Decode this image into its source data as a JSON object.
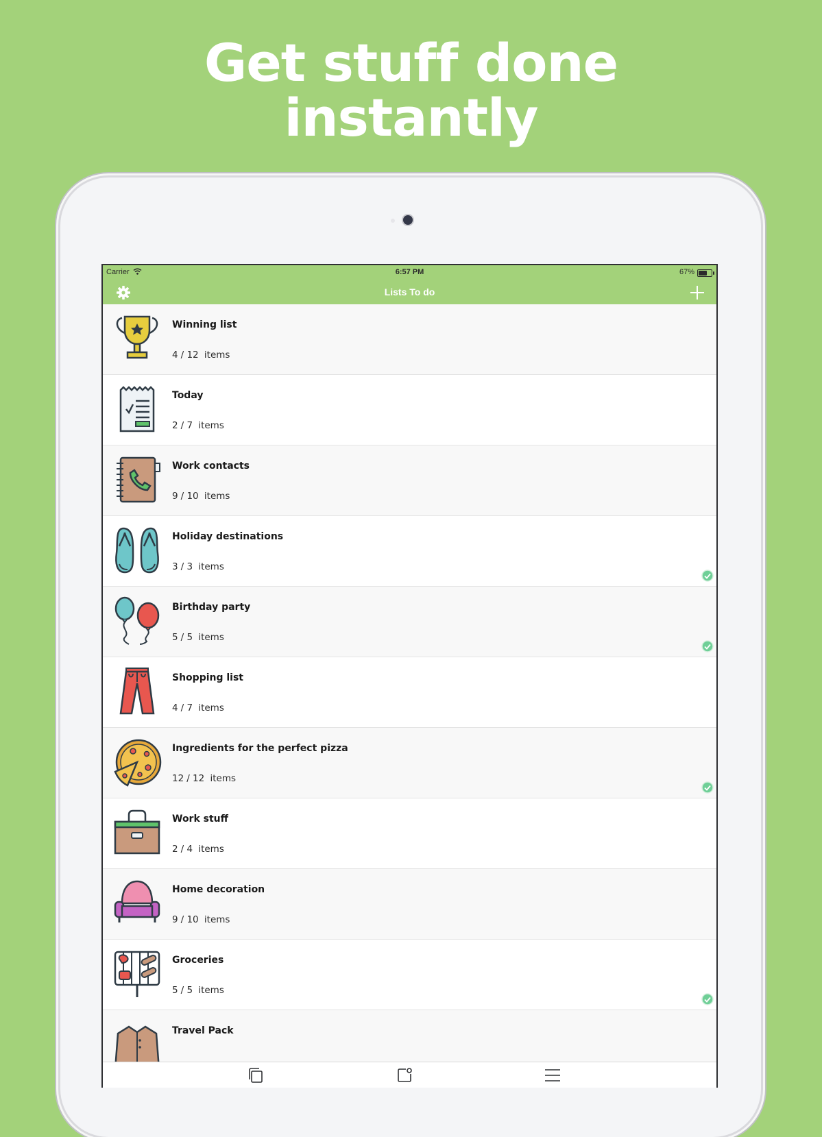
{
  "headline": {
    "line1": "Get stuff done",
    "line2": "instantly"
  },
  "status_bar": {
    "carrier": "Carrier",
    "time": "6:57 PM",
    "battery": "67%",
    "battery_level": 0.67
  },
  "nav": {
    "title": "Lists To do",
    "left_icon": "gear-icon",
    "right_icon": "plus-icon"
  },
  "lists": [
    {
      "name": "Winning list",
      "done": "4",
      "total": "12",
      "unit": "items",
      "icon": "trophy-icon",
      "complete": false
    },
    {
      "name": "Today",
      "done": "2",
      "total": "7",
      "unit": "items",
      "icon": "receipt-icon",
      "complete": false
    },
    {
      "name": "Work contacts",
      "done": "9",
      "total": "10",
      "unit": "items",
      "icon": "address-book-icon",
      "complete": false
    },
    {
      "name": "Holiday destinations",
      "done": "3",
      "total": "3",
      "unit": "items",
      "icon": "flip-flops-icon",
      "complete": true
    },
    {
      "name": "Birthday party",
      "done": "5",
      "total": "5",
      "unit": "items",
      "icon": "balloons-icon",
      "complete": true
    },
    {
      "name": "Shopping list",
      "done": "4",
      "total": "7",
      "unit": "items",
      "icon": "pants-icon",
      "complete": false
    },
    {
      "name": "Ingredients for the perfect pizza",
      "done": "12",
      "total": "12",
      "unit": "items",
      "icon": "pizza-icon",
      "complete": true
    },
    {
      "name": "Work stuff",
      "done": "2",
      "total": "4",
      "unit": "items",
      "icon": "toolbox-icon",
      "complete": false
    },
    {
      "name": "Home decoration",
      "done": "9",
      "total": "10",
      "unit": "items",
      "icon": "armchair-icon",
      "complete": false
    },
    {
      "name": "Groceries",
      "done": "5",
      "total": "5",
      "unit": "items",
      "icon": "grill-icon",
      "complete": true
    },
    {
      "name": "Travel Pack",
      "done": "",
      "total": "",
      "unit": "",
      "icon": "jacket-icon",
      "complete": false
    }
  ],
  "tab_bar": {
    "icons": [
      "copy-icon",
      "notification-icon",
      "menu-icon"
    ]
  },
  "colors": {
    "brand_green": "#a3d27a",
    "check_green": "#6fcf97"
  }
}
